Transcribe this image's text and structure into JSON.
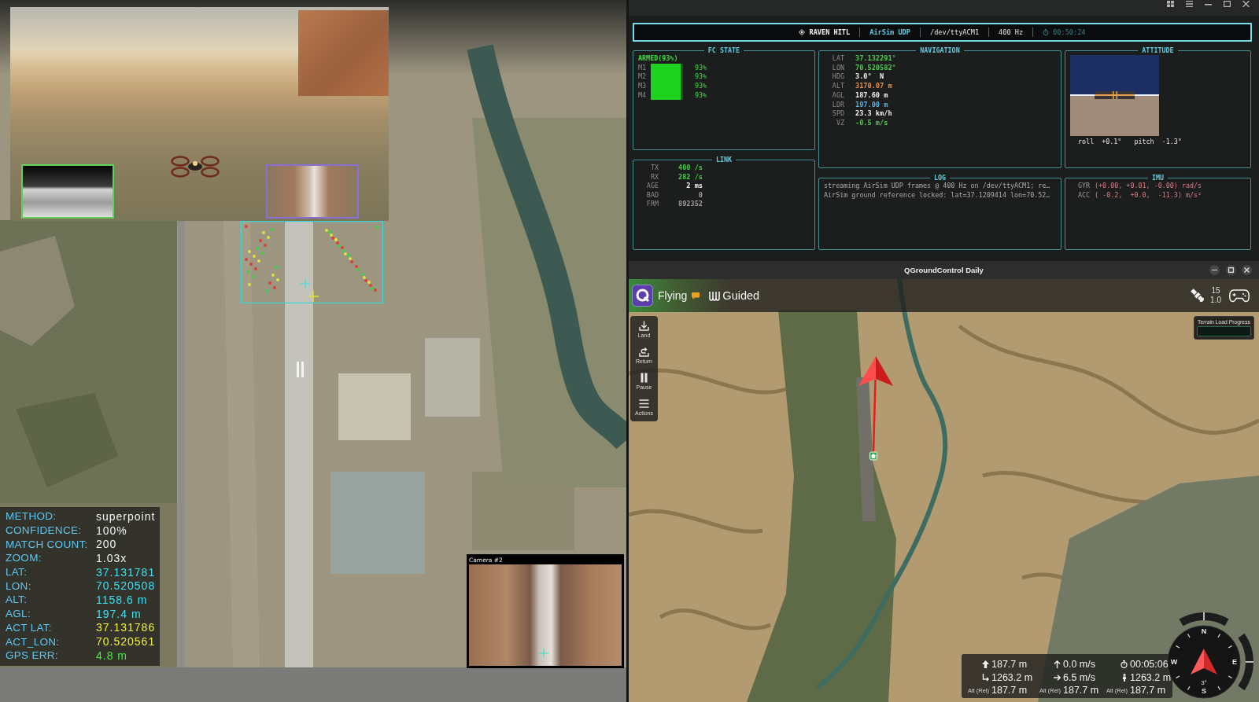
{
  "match_overlay": {
    "rows": [
      {
        "label": "METHOD:",
        "value": "superpoint",
        "color": "#f2f2f2"
      },
      {
        "label": "CONFIDENCE:",
        "value": "100%",
        "color": "#f2f2f2"
      },
      {
        "label": "MATCH COUNT:",
        "value": "200",
        "color": "#f2f2f2"
      },
      {
        "label": "ZOOM:",
        "value": "1.03x",
        "color": "#f2f2f2"
      },
      {
        "label": "LAT:",
        "value": "37.131781",
        "color": "#3fe0f0"
      },
      {
        "label": "LON:",
        "value": "70.520508",
        "color": "#3fe0f0"
      },
      {
        "label": "ALT:",
        "value": "1158.6 m",
        "color": "#3fe0f0"
      },
      {
        "label": "AGL:",
        "value": "197.4 m",
        "color": "#3fe0f0"
      },
      {
        "label": "ACT LAT:",
        "value": "37.131786",
        "color": "#f0f03c"
      },
      {
        "label": "ACT_LON:",
        "value": "70.520561",
        "color": "#f0f03c"
      },
      {
        "label": "GPS ERR:",
        "value": "4.8 m",
        "color": "#3cf03c"
      }
    ]
  },
  "camera_inset": {
    "label": "Camera #2"
  },
  "terminal": {
    "header": [
      {
        "kind": "title",
        "text": "RAVEN HITL"
      },
      {
        "kind": "source",
        "text": "AirSim UDP"
      },
      {
        "kind": "plain",
        "text": "/dev/ttyACM1"
      },
      {
        "kind": "plain",
        "text": "400 Hz"
      },
      {
        "kind": "timer",
        "text": "00:50:24"
      }
    ],
    "fc_state": {
      "title": "FC STATE",
      "status": "ARMED(93%)",
      "motors": [
        {
          "name": "M1",
          "level": 0.93,
          "reading": "93%"
        },
        {
          "name": "M2",
          "level": 0.93,
          "reading": "93%"
        },
        {
          "name": "M3",
          "level": 0.93,
          "reading": "93%"
        },
        {
          "name": "M4",
          "level": 0.93,
          "reading": "93%"
        }
      ]
    },
    "link": {
      "title": "LINK",
      "rows": [
        {
          "label": "TX",
          "value": "400 /s",
          "color": "#3ccf3c"
        },
        {
          "label": "RX",
          "value": "282 /s",
          "color": "#3ccf3c"
        },
        {
          "label": "AGE",
          "value": "2 ms",
          "color": "#f0f0f0"
        },
        {
          "label": "BAD",
          "value": "0",
          "color": "#9a9a9a"
        },
        {
          "label": "FRM",
          "value": "892352",
          "color": "#9a9a9a"
        }
      ]
    },
    "navigation": {
      "title": "NAVIGATION",
      "rows": [
        {
          "label": "LAT",
          "value": "37.132291°",
          "color": "#4cc94c"
        },
        {
          "label": "LON",
          "value": "70.520582°",
          "color": "#4cc94c"
        },
        {
          "label": "HDG",
          "value": "3.0°  N",
          "color": "#f0f0f0"
        },
        {
          "label": "ALT",
          "value": "3170.07 m",
          "color": "#e0904a"
        },
        {
          "label": "AGL",
          "value": "187.60 m",
          "color": "#f0f0f0"
        },
        {
          "label": "LDR",
          "value": "197.00 m",
          "color": "#5aaee0"
        },
        {
          "label": "SPD",
          "value": "23.3 km/h",
          "color": "#f0f0f0"
        },
        {
          "label": "VZ",
          "value": "-0.5 m/s",
          "color": "#4cc94c"
        }
      ]
    },
    "log": {
      "title": "LOG",
      "lines": [
        "streaming AirSim UDP frames @ 400 Hz on /dev/ttyACM1; re…",
        "AirSim ground reference locked: lat=37.1209414 lon=70.52…"
      ]
    },
    "attitude": {
      "title": "ATTITUDE",
      "readings": [
        {
          "label": "roll",
          "value": "+0.1°"
        },
        {
          "label": "pitch",
          "value": "-1.3°"
        }
      ]
    },
    "imu": {
      "title": "IMU",
      "rows": [
        {
          "label": "GYR",
          "value": "(+0.00, +0.01, -0.00) rad/s"
        },
        {
          "label": "ACC",
          "value": "( -0.2,  +0.0,  -11.3) m/s²"
        }
      ]
    }
  },
  "qgc": {
    "window": {
      "title": "QGroundControl Daily"
    },
    "toolbar": {
      "flight_state": "Flying",
      "flight_mode": "Guided",
      "satellites": "15",
      "hdop": "1.0"
    },
    "tools": [
      {
        "kind": "land",
        "label": "Land"
      },
      {
        "kind": "return",
        "label": "Return"
      },
      {
        "kind": "pause",
        "label": "Pause"
      },
      {
        "kind": "actions",
        "label": "Actions"
      }
    ],
    "terrain": {
      "label": "Terrain Load Progress"
    },
    "telemetry": [
      {
        "kind": "altitude",
        "value": "187.7 m"
      },
      {
        "kind": "vertical_speed",
        "value": "0.0 m/s"
      },
      {
        "kind": "flight_time",
        "value": "00:05:06"
      },
      {
        "kind": "distance_home",
        "value": "1263.2 m"
      },
      {
        "kind": "ground_speed",
        "value": "6.5 m/s"
      },
      {
        "kind": "distance_gcs",
        "value": "1263.2 m"
      },
      {
        "kind": "alt_rel",
        "label": "Alt (Rel)",
        "value": "187.7 m"
      },
      {
        "kind": "alt_rel",
        "label": "Alt (Rel)",
        "value": "187.7 m"
      },
      {
        "kind": "alt_rel",
        "label": "Alt (Rel)",
        "value": "187.7 m"
      }
    ],
    "compass": {
      "north": "N",
      "east": "E",
      "south": "S",
      "west": "W",
      "heading": "3°"
    }
  }
}
